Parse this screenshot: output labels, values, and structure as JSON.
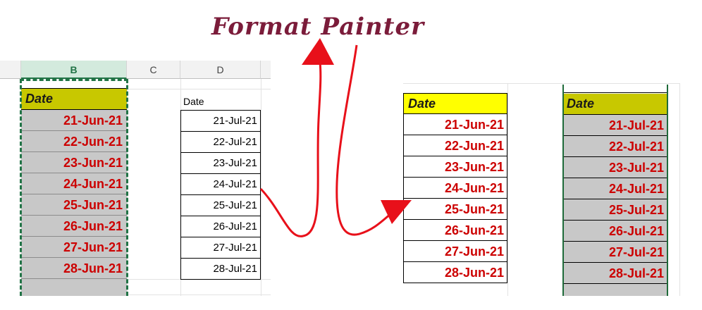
{
  "title": "Format Painter",
  "colors": {
    "title": "#7b1c3a",
    "date_red": "#cc0000",
    "header_olive": "#c8c800",
    "header_yellow": "#ffff00",
    "arrow": "#e8101a",
    "selection": "#217346"
  },
  "left_sheet": {
    "columns": [
      "B",
      "C",
      "D"
    ],
    "b_header": "Date",
    "b_values": [
      "21-Jun-21",
      "22-Jun-21",
      "23-Jun-21",
      "24-Jun-21",
      "25-Jun-21",
      "26-Jun-21",
      "27-Jun-21",
      "28-Jun-21"
    ],
    "d_header": "Date",
    "d_values": [
      "21-Jul-21",
      "22-Jul-21",
      "23-Jul-21",
      "24-Jul-21",
      "25-Jul-21",
      "26-Jul-21",
      "27-Jul-21",
      "28-Jul-21"
    ]
  },
  "right_result": {
    "first_header": "Date",
    "first_values": [
      "21-Jun-21",
      "22-Jun-21",
      "23-Jun-21",
      "24-Jun-21",
      "25-Jun-21",
      "26-Jun-21",
      "27-Jun-21",
      "28-Jun-21"
    ],
    "second_header": "Date",
    "second_values": [
      "21-Jul-21",
      "22-Jul-21",
      "23-Jul-21",
      "24-Jul-21",
      "25-Jul-21",
      "26-Jul-21",
      "27-Jul-21",
      "28-Jul-21"
    ]
  }
}
